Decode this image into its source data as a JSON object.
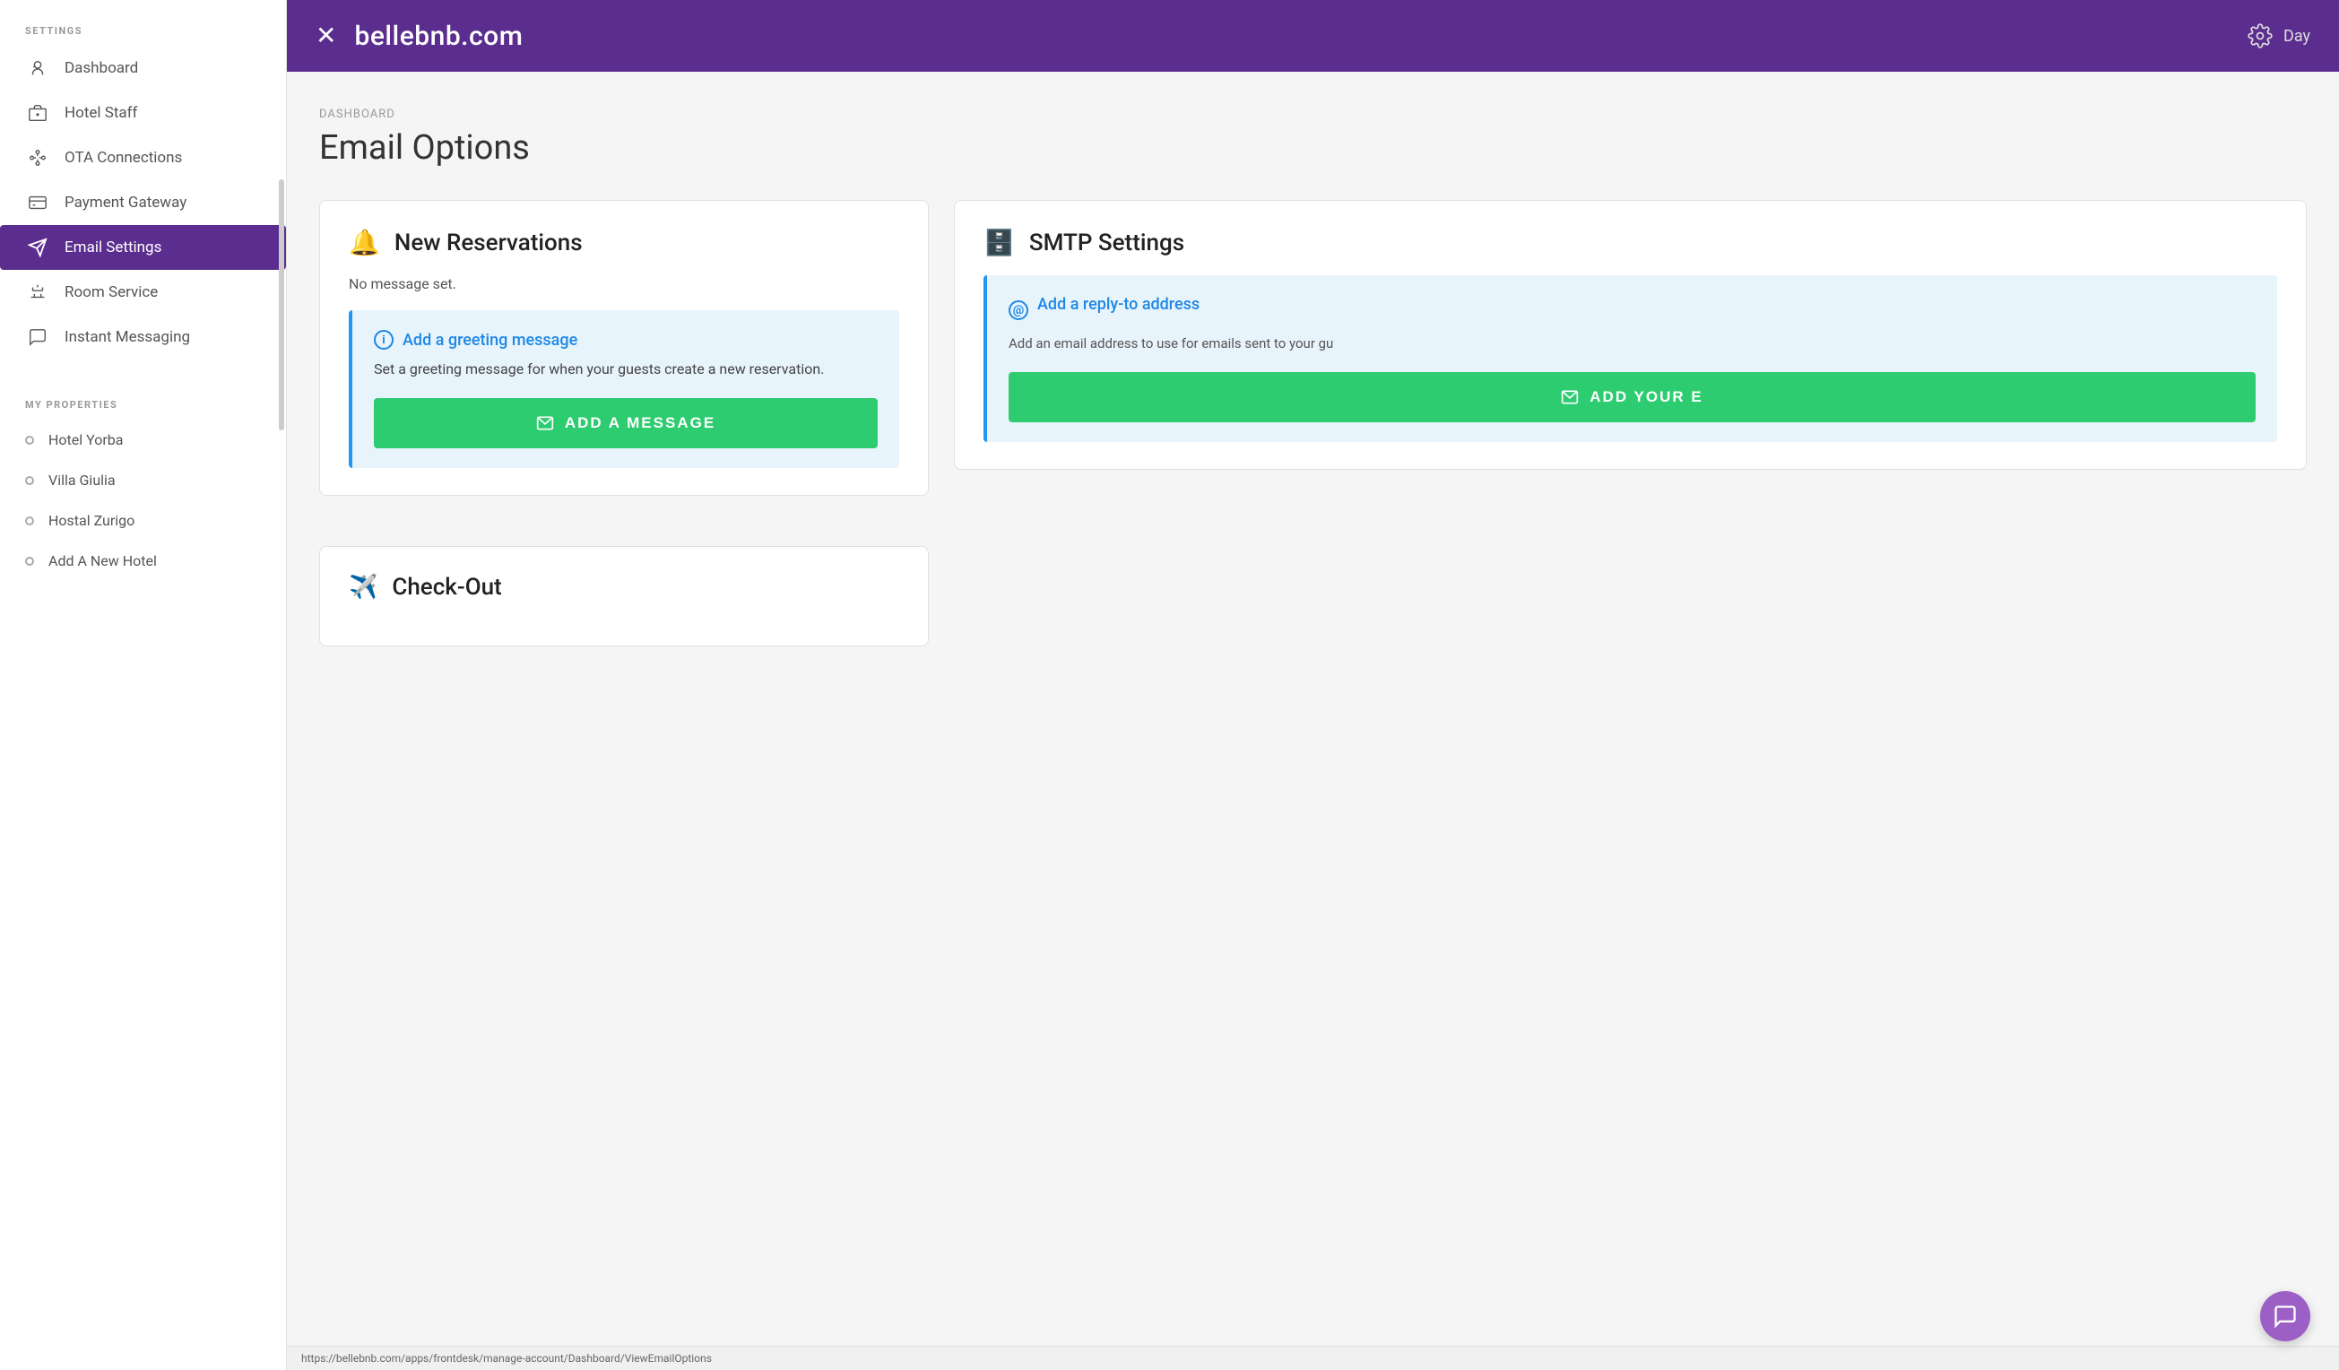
{
  "topbar": {
    "close_icon": "×",
    "title": "bellebnb.com",
    "gear_icon": "⚙",
    "day_label": "Day"
  },
  "sidebar": {
    "settings_label": "SETTINGS",
    "items": [
      {
        "id": "dashboard",
        "label": "Dashboard"
      },
      {
        "id": "hotel-staff",
        "label": "Hotel Staff"
      },
      {
        "id": "ota-connections",
        "label": "OTA Connections"
      },
      {
        "id": "payment-gateway",
        "label": "Payment Gateway"
      },
      {
        "id": "email-settings",
        "label": "Email Settings",
        "active": true
      },
      {
        "id": "room-service",
        "label": "Room Service"
      },
      {
        "id": "instant-messaging",
        "label": "Instant Messaging"
      }
    ],
    "properties_label": "MY PROPERTIES",
    "properties": [
      {
        "id": "hotel-yorba",
        "label": "Hotel Yorba"
      },
      {
        "id": "villa-giulia",
        "label": "Villa Giulia"
      },
      {
        "id": "hostal-zurigo",
        "label": "Hostal Zurigo"
      },
      {
        "id": "add-new-hotel",
        "label": "Add A New Hotel"
      }
    ]
  },
  "breadcrumb": "DASHBOARD",
  "page_title": "Email Options",
  "new_reservations_card": {
    "title": "New Reservations",
    "no_message": "No message set.",
    "info_title": "Add a greeting message",
    "info_desc": "Set a greeting message for when your guests create a new reservation.",
    "button_label": "ADD A MESSAGE"
  },
  "smtp_card": {
    "title": "SMTP Settings",
    "info_title": "Add a reply-to address",
    "info_desc": "Add an email address to use for emails sent to your gu",
    "button_label": "ADD YOUR E"
  },
  "checkout_card": {
    "title": "Check-Out"
  },
  "status_bar_url": "https://bellebnb.com/apps/frontdesk/manage-account/Dashboard/ViewEmailOptions"
}
